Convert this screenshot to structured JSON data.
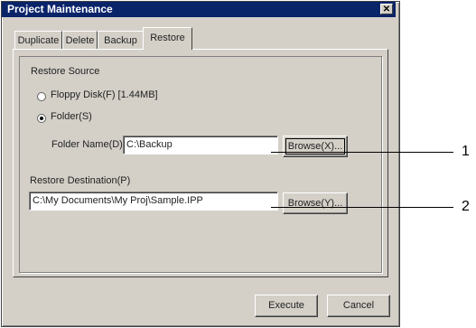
{
  "window": {
    "title": "Project Maintenance",
    "close_glyph": "✕"
  },
  "tabs": [
    {
      "label": "Duplicate"
    },
    {
      "label": "Delete"
    },
    {
      "label": "Backup"
    },
    {
      "label": "Restore",
      "active": true
    }
  ],
  "restore_source": {
    "group_label": "Restore Source",
    "floppy_option": "Floppy Disk(F) [1.44MB]",
    "folder_option": "Folder(S)",
    "selected": "folder",
    "folder_name_label": "Folder Name(D)",
    "folder_name_value": "C:\\Backup",
    "browse_label": "Browse(X)..."
  },
  "restore_destination": {
    "label": "Restore Destination(P)",
    "value": "C:\\My Documents\\My Proj\\Sample.IPP",
    "browse_label": "Browse(Y)..."
  },
  "actions": {
    "execute_label": "Execute",
    "cancel_label": "Cancel"
  },
  "callouts": [
    "1",
    "2"
  ],
  "icons": {
    "close": "close-icon"
  }
}
